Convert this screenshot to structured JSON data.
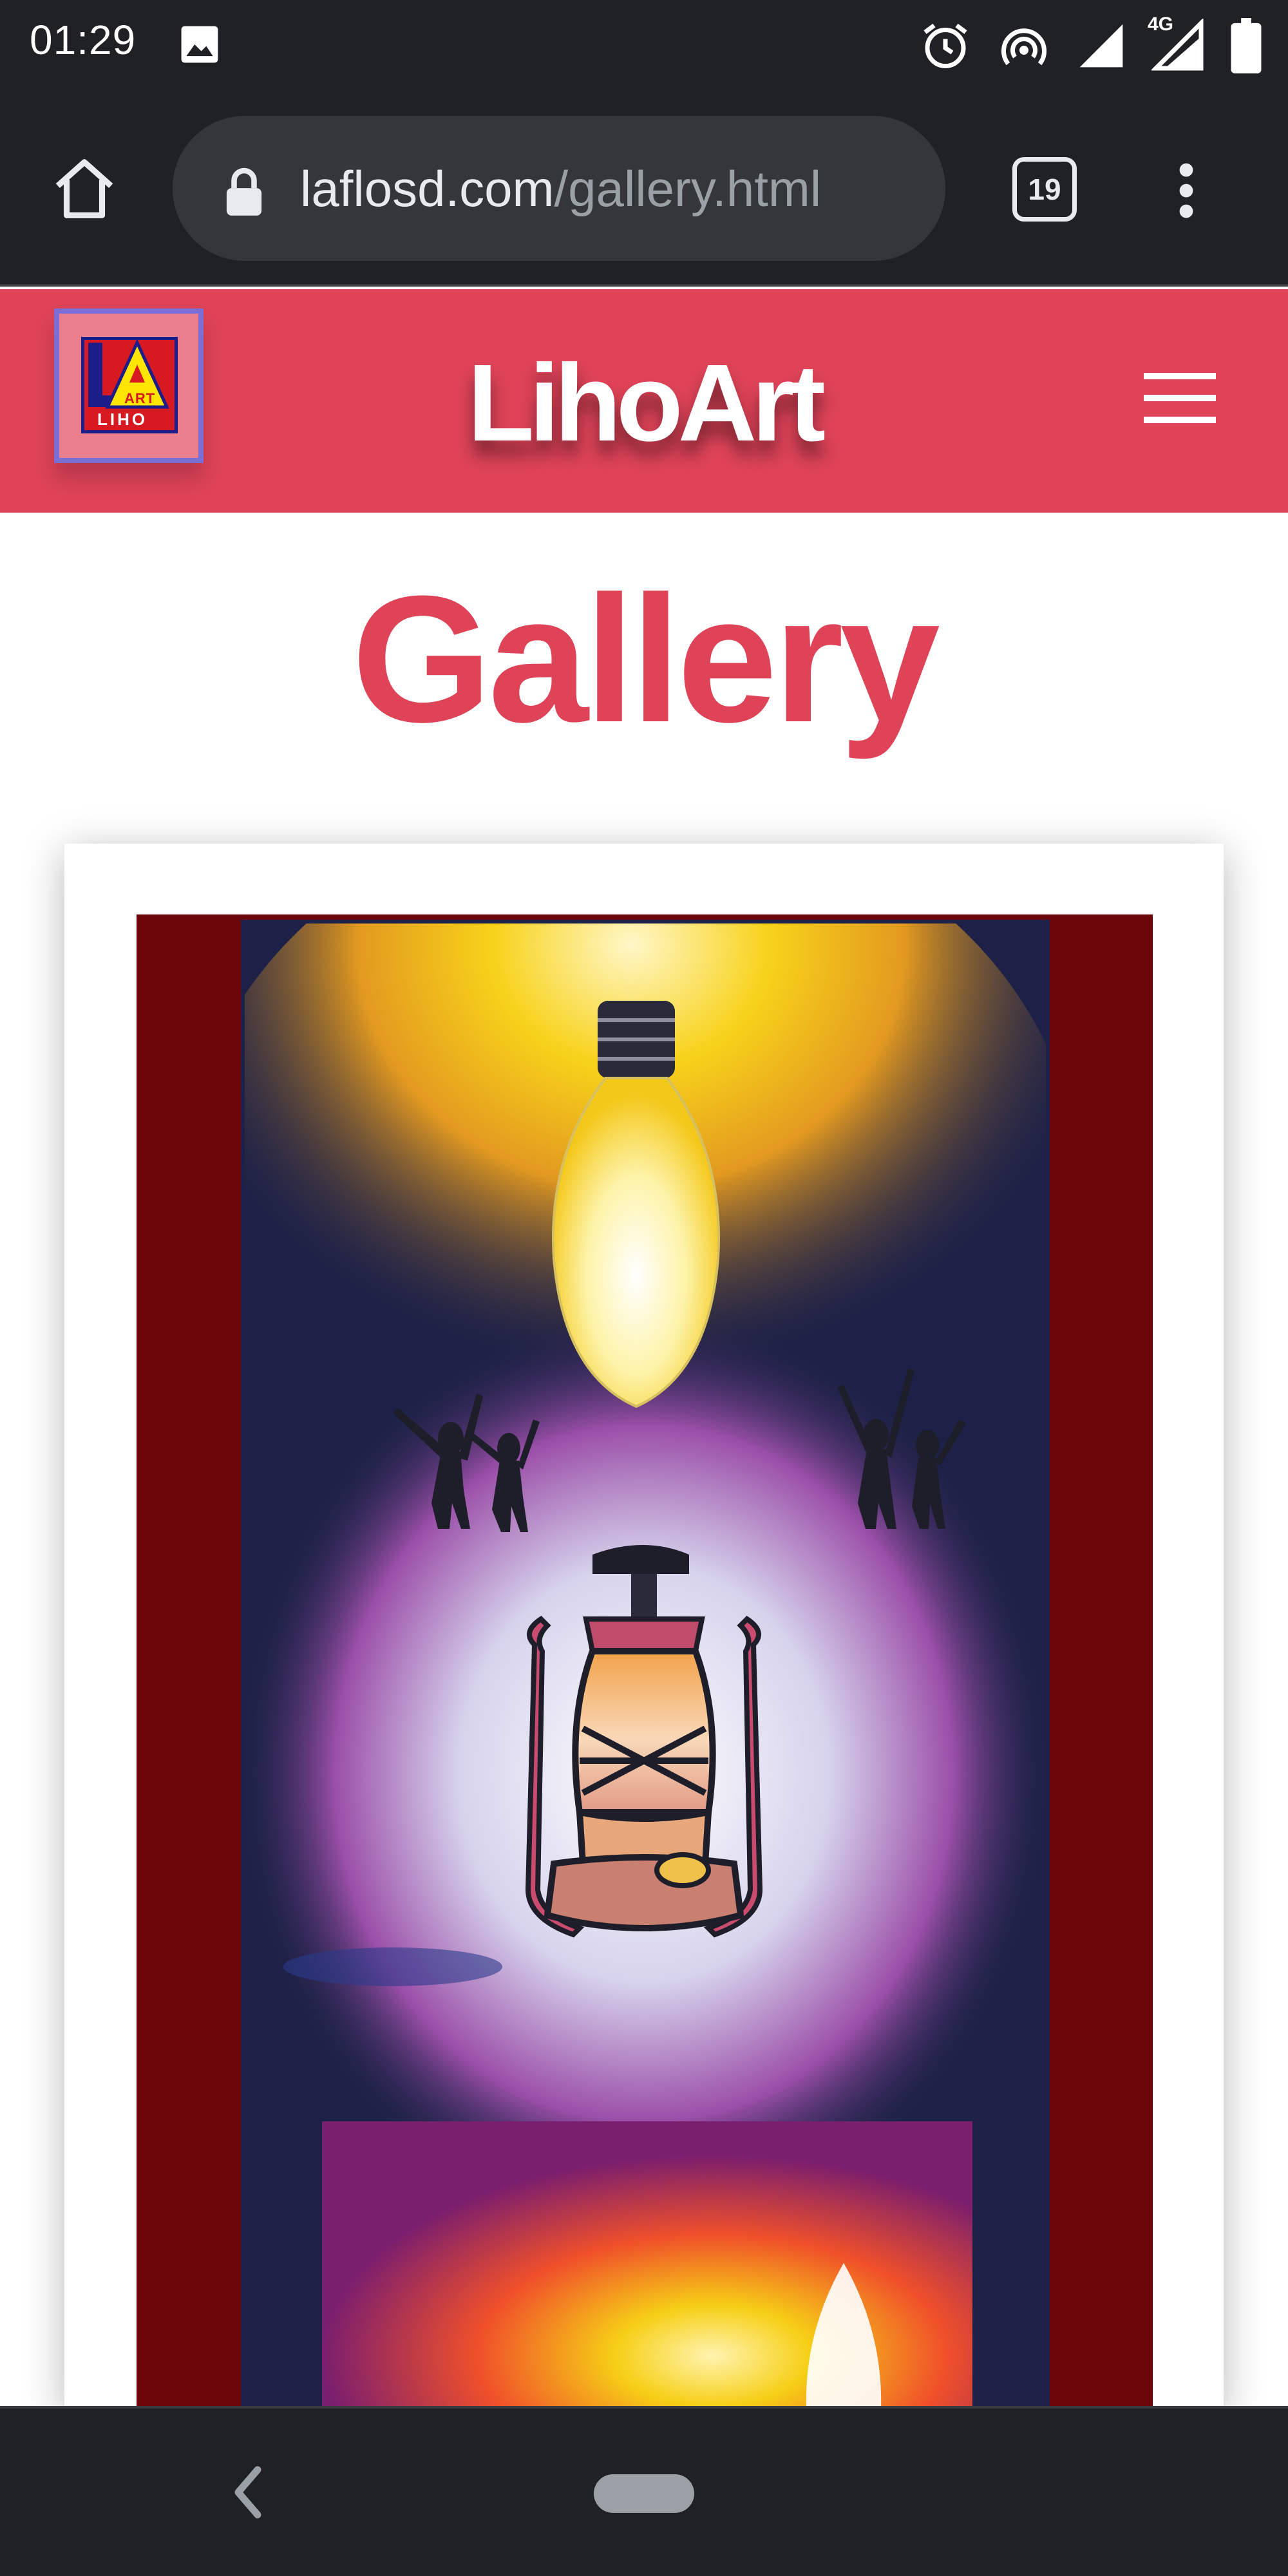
{
  "status_bar": {
    "time": "01:29",
    "network_label": "4G",
    "icons": [
      "image-icon",
      "alarm-icon",
      "hotspot-icon",
      "signal-icon",
      "4g-signal-icon",
      "battery-icon"
    ]
  },
  "browser": {
    "url_domain": "laflosd.com",
    "url_path": "/gallery.html",
    "tab_count": "19",
    "icons": [
      "home-icon",
      "lock-icon",
      "more-vert-icon"
    ]
  },
  "site": {
    "brand": "LihoArt",
    "logo_text_art": "ART",
    "logo_text_liho": "LIHO",
    "colors": {
      "header": "#df4358",
      "title": "#df4358",
      "frame": "#6b0509"
    }
  },
  "main": {
    "title": "Gallery",
    "artworks": [
      {
        "subject": "lantern-and-light-bulb-painting"
      }
    ]
  },
  "nav_bar": {
    "icons": [
      "back-icon",
      "home-pill"
    ]
  }
}
